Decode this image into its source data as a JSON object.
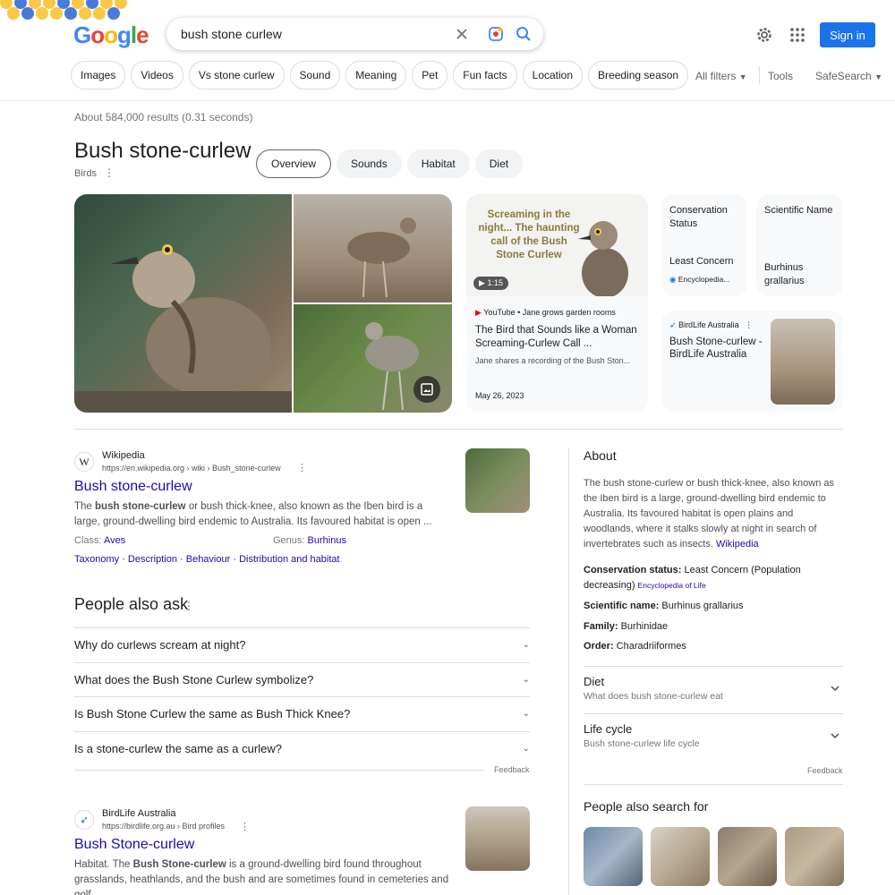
{
  "search": {
    "query": "bush stone curlew"
  },
  "header": {
    "logo": "Google",
    "signin": "Sign in"
  },
  "chips": [
    "Images",
    "Videos",
    "Vs stone curlew",
    "Sound",
    "Meaning",
    "Pet",
    "Fun facts",
    "Location",
    "Breeding season"
  ],
  "filters": {
    "all_filters": "All filters",
    "tools": "Tools",
    "safesearch": "SafeSearch"
  },
  "results_count": "About 584,000 results (0.31 seconds)",
  "knowledge": {
    "title": "Bush stone-curlew",
    "subtitle": "Birds",
    "tabs": [
      "Overview",
      "Sounds",
      "Habitat",
      "Diet"
    ]
  },
  "video": {
    "thumb_text": "Screaming in the night... The haunting call of the Bush Stone Curlew",
    "duration": "1:15",
    "source": "YouTube • Jane grows garden rooms",
    "title": "The Bird that Sounds like a Woman Screaming-Curlew Call ...",
    "desc": "Jane shares a recording of the Bush Ston...",
    "date": "May 26, 2023"
  },
  "cards": {
    "conservation_label": "Conservation Status",
    "conservation_value": "Least Concern",
    "conservation_source": "Encyclopedia...",
    "scientific_label": "Scientific Name",
    "scientific_value": "Burhinus grallarius",
    "birdlife_source": "BirdLife Australia",
    "birdlife_title": "Bush Stone-curlew - BirdLife Australia"
  },
  "result1": {
    "site": "Wikipedia",
    "url": "https://en.wikipedia.org › wiki › Bush_stone-curlew",
    "title": "Bush stone-curlew",
    "snippet_pre": "The ",
    "snippet_bold": "bush stone-curlew",
    "snippet_post": " or bush thick-knee, also known as the Iben bird is a large, ground-dwelling bird endemic to Australia. Its favoured habitat is open ...",
    "class_label": "Class: ",
    "class_value": "Aves",
    "genus_label": "Genus: ",
    "genus_value": "Burhinus",
    "links": [
      "Taxonomy",
      "Description",
      "Behaviour",
      "Distribution and habitat"
    ]
  },
  "paa": {
    "title": "People also ask",
    "questions": [
      "Why do curlews scream at night?",
      "What does the Bush Stone Curlew symbolize?",
      "Is Bush Stone Curlew the same as Bush Thick Knee?",
      "Is a stone-curlew the same as a curlew?"
    ],
    "feedback": "Feedback"
  },
  "result2": {
    "site": "BirdLife Australia",
    "url": "https://birdlife.org.au › Bird profiles",
    "title": "Bush Stone-curlew",
    "snippet_pre": "Habitat. The ",
    "snippet_bold": "Bush Stone-curlew",
    "snippet_post": " is a ground-dwelling bird found throughout grasslands, heathlands, and the bush and are sometimes found in cemeteries and golf ..."
  },
  "panel": {
    "about": "About",
    "desc": "The bush stone-curlew or bush thick-knee, also known as the Iben bird is a large, ground-dwelling bird endemic to Australia. Its favoured habitat is open plains and woodlands, where it stalks slowly at night in search of invertebrates such as insects.",
    "desc_link": "Wikipedia",
    "conservation_label": "Conservation status:",
    "conservation_value": " Least Concern (Population decreasing)",
    "conservation_source": "Encyclopedia of Life",
    "scientific_label": "Scientific name:",
    "scientific_value": " Burhinus grallarius",
    "family_label": "Family:",
    "family_value": " Burhinidae",
    "order_label": "Order:",
    "order_value": " Charadriiformes",
    "diet_title": "Diet",
    "diet_sub": "What does bush stone-curlew eat",
    "life_title": "Life cycle",
    "life_sub": "Bush stone-curlew life cycle",
    "feedback": "Feedback",
    "pasf_title": "People also search for"
  }
}
